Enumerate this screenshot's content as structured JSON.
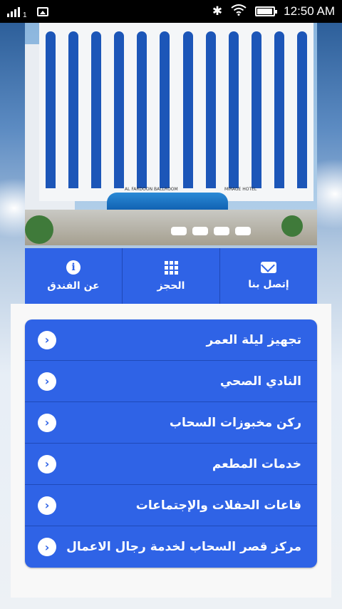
{
  "status_bar": {
    "sim_number": "1",
    "time": "12:50 AM"
  },
  "hero": {
    "sign_left": "AL FARDOON BALLROOM",
    "sign_right": "MIRAGE HOTEL"
  },
  "actions": [
    {
      "label": "عن الفندق",
      "icon": "info-icon"
    },
    {
      "label": "الحجز",
      "icon": "grid-icon"
    },
    {
      "label": "إتصل بنا",
      "icon": "mail-icon"
    }
  ],
  "menu": [
    {
      "label": "تجهيز ليلة العمر"
    },
    {
      "label": "النادي الصحي"
    },
    {
      "label": "ركن مخبوزات السحاب"
    },
    {
      "label": "خدمات المطعم"
    },
    {
      "label": "قاعات الحفلات والإجتماعات"
    },
    {
      "label": "مركز قصر السحاب لخدمة رجال الاعمال"
    }
  ],
  "colors": {
    "accent": "#2f63e6",
    "divider": "#1f49b8",
    "status_bar": "#000000"
  }
}
